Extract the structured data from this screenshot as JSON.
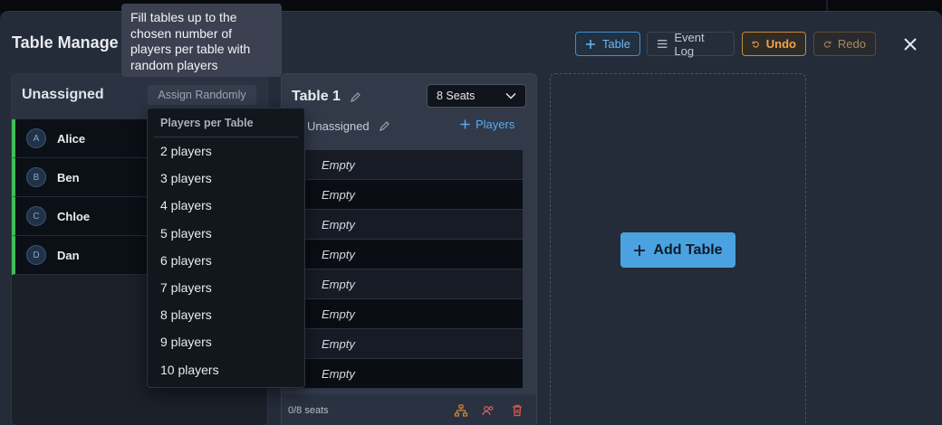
{
  "modal": {
    "title": "Table Manage",
    "header_buttons": {
      "table_label": "Table",
      "event_log_label": "Event Log",
      "undo_label": "Undo",
      "redo_label": "Redo"
    }
  },
  "tooltip": {
    "text": "Fill tables up to the chosen number of players per table with random players"
  },
  "unassigned": {
    "title": "Unassigned",
    "assign_randomly_label": "Assign Randomly",
    "players": [
      {
        "initial": "A",
        "name": "Alice"
      },
      {
        "initial": "B",
        "name": "Ben"
      },
      {
        "initial": "C",
        "name": "Chloe"
      },
      {
        "initial": "D",
        "name": "Dan"
      }
    ]
  },
  "dropdown": {
    "header": "Players per Table",
    "options": [
      "2 players",
      "3 players",
      "4 players",
      "5 players",
      "6 players",
      "7 players",
      "8 players",
      "9 players",
      "10 players"
    ]
  },
  "table1": {
    "title": "Table 1",
    "seats_selected": "8 Seats",
    "subtitle": "Unassigned",
    "players_link": "Players",
    "seats": [
      "Empty",
      "Empty",
      "Empty",
      "Empty",
      "Empty",
      "Empty",
      "Empty",
      "Empty"
    ],
    "seat_count": "0/8 seats"
  },
  "add_table": {
    "label": "Add Table"
  },
  "colors": {
    "accent": "#4aa3e0",
    "undo": "#f0a44a",
    "assigned_bar": "#3fbf55",
    "delete": "#e05a4a"
  }
}
